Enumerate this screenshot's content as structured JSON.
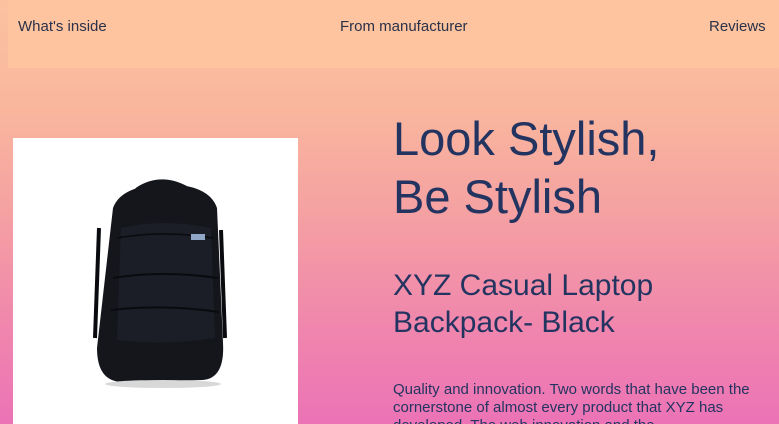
{
  "nav": {
    "whats_inside": "What's inside",
    "from_manufacturer": "From manufacturer",
    "reviews": "Reviews"
  },
  "hero": {
    "headline_line1": "Look Stylish,",
    "headline_line2": "Be Stylish",
    "product_title_line1": "XYZ Casual Laptop",
    "product_title_line2": "Backpack- Black",
    "description": "Quality and innovation. Two words that have been the cornerstone of almost every product that XYZ has developed. The web innovation and the"
  },
  "product_image": {
    "icon": "backpack-image",
    "color": "#0f1117"
  },
  "colors": {
    "text": "#243461",
    "nav_background": "#fdc49f",
    "gradient_top": "#fbc2a0",
    "gradient_bottom": "#ec73b6"
  }
}
